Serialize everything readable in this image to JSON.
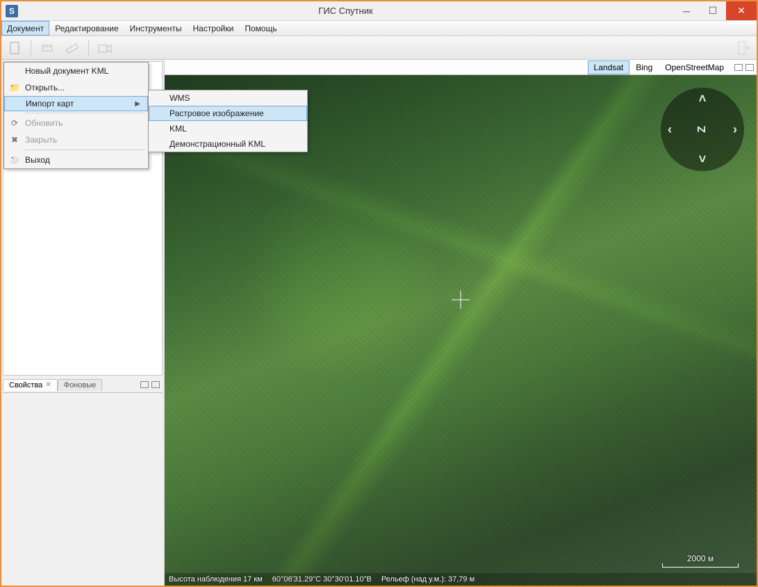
{
  "app": {
    "title": "ГИС Спутник",
    "icon_letter": "S"
  },
  "menubar": {
    "items": [
      "Документ",
      "Редактирование",
      "Инструменты",
      "Настройки",
      "Помощь"
    ],
    "open_index": 0
  },
  "document_menu": {
    "items": [
      {
        "label": "Новый документ KML",
        "icon": "",
        "disabled": false
      },
      {
        "label": "Открыть...",
        "icon": "folder",
        "disabled": false
      },
      {
        "label": "Импорт карт",
        "icon": "",
        "disabled": false,
        "submenu": true,
        "selected": true
      },
      {
        "label": "Обновить",
        "icon": "refresh",
        "disabled": true
      },
      {
        "label": "Закрыть",
        "icon": "close",
        "disabled": true
      },
      {
        "label": "Выход",
        "icon": "exit",
        "disabled": false
      }
    ]
  },
  "import_submenu": {
    "items": [
      "WMS",
      "Растровое изображение",
      "KML",
      "Демонстрационный KML"
    ],
    "selected_index": 1
  },
  "map_tabs": {
    "items": [
      "Landsat",
      "Bing",
      "OpenStreetMap"
    ],
    "active_index": 0
  },
  "left_panel": {
    "tabs": {
      "properties": "Свойства",
      "background": "Фоновые",
      "close_glyph": "✕"
    }
  },
  "compass": {
    "center": "Z"
  },
  "scale": {
    "label": "2000 м"
  },
  "status": {
    "altitude_label": "Высота наблюдения 17 км",
    "coords": "60°06'31.29\"С 30°30'01.10\"В",
    "relief_label": "Рельеф (над у.м.): 37,79 м"
  }
}
